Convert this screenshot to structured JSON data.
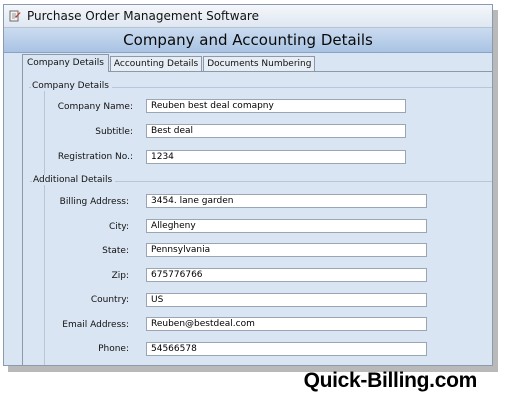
{
  "window": {
    "title": "Purchase Order Management Software"
  },
  "header": {
    "title": "Company and Accounting Details"
  },
  "tabs": [
    {
      "label": "Company Details",
      "active": true
    },
    {
      "label": "Accounting Details",
      "active": false
    },
    {
      "label": "Documents Numbering",
      "active": false
    }
  ],
  "company_details": {
    "group_label": "Company Details",
    "fields": [
      {
        "label": "Company Name:",
        "value": "Reuben best deal comapny"
      },
      {
        "label": "Subtitle:",
        "value": "Best deal"
      },
      {
        "label": "Registration No.:",
        "value": "1234"
      }
    ]
  },
  "additional_details": {
    "group_label": "Additional Details",
    "fields": [
      {
        "label": "Billing Address:",
        "value": "3454. lane garden"
      },
      {
        "label": "City:",
        "value": "Allegheny"
      },
      {
        "label": "State:",
        "value": "Pennsylvania"
      },
      {
        "label": "Zip:",
        "value": "675776766"
      },
      {
        "label": "Country:",
        "value": "US"
      },
      {
        "label": "Email Address:",
        "value": "Reuben@bestdeal.com"
      },
      {
        "label": "Phone:",
        "value": "54566578"
      }
    ]
  },
  "brand": {
    "text": "Quick-Billing.com"
  }
}
